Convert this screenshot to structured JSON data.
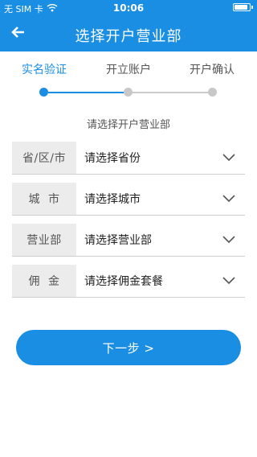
{
  "status_bar": {
    "carrier": "无 SIM 卡",
    "wifi_icon": "wifi-icon",
    "time": "10:06",
    "battery_icon": "battery-icon",
    "battery_level": 0.9
  },
  "nav": {
    "back_icon": "arrow-left-icon",
    "title": "选择开户营业部"
  },
  "steps": {
    "items": [
      {
        "label": "实名验证",
        "state": "active"
      },
      {
        "label": "开立账户",
        "state": "pending"
      },
      {
        "label": "开户确认",
        "state": "pending"
      }
    ]
  },
  "form": {
    "prompt": "请选择开户营业部",
    "rows": [
      {
        "label": "省/区/市",
        "value": "请选择省份"
      },
      {
        "label": "城  市",
        "value": "请选择城市"
      },
      {
        "label": "营业部",
        "value": "请选择营业部"
      },
      {
        "label": "佣  金",
        "value": "请选择佣金套餐"
      }
    ],
    "chevron_icon": "chevron-down-icon"
  },
  "actions": {
    "next_label": "下一步 >"
  },
  "colors": {
    "brand": "#1a8ee3",
    "label_bg": "#ececec",
    "divider": "#cfcfcf",
    "inactive_dot": "#c8c8c8"
  }
}
